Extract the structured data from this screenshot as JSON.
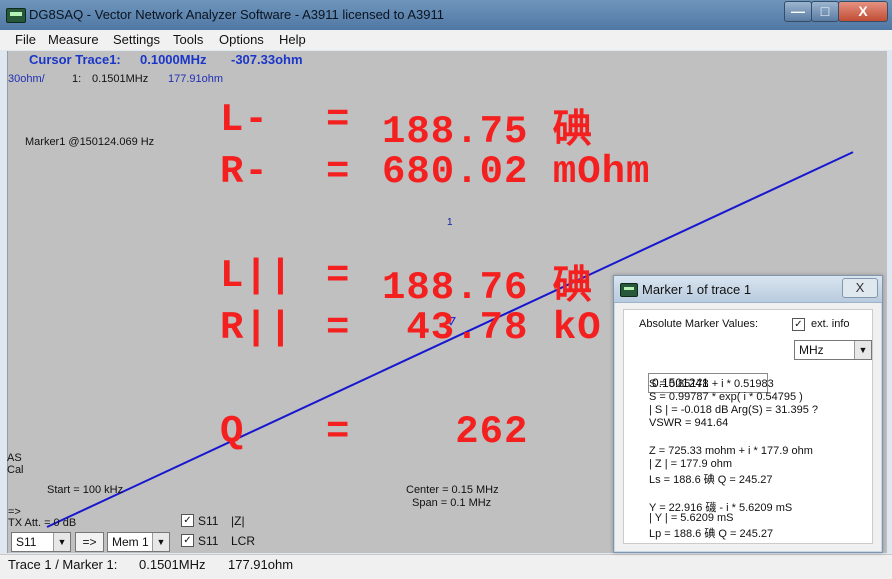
{
  "window": {
    "title": "DG8SAQ  -  Vector Network Analyzer Software  - A3911 licensed to A3911",
    "buttons": {
      "minimize": "—",
      "maximize": "□",
      "close": "X"
    }
  },
  "menubar": [
    "File",
    "Measure",
    "Settings",
    "Tools",
    "Options",
    "Help"
  ],
  "cursor": {
    "label": "Cursor Trace1:",
    "frequency": "0.1000MHz",
    "value": "-307.33ohm"
  },
  "scale_label": "30ohm/",
  "trace_readout": {
    "index": "1:",
    "frequency": "0.1501MHz",
    "value": "177.91ohm"
  },
  "marker_text": "Marker1 @150124.069 Hz",
  "marker_number": "1",
  "overlay": [
    {
      "label": "L-",
      "value": "188.75 碘"
    },
    {
      "label": "R-",
      "value": "680.02 mOhm"
    },
    {
      "label": "L||",
      "value": "188.76 碘"
    },
    {
      "label": "R||",
      "value": " 43.78 kO"
    },
    {
      "label": "Q",
      "value": "   262"
    }
  ],
  "bottom_left": {
    "as": "AS",
    "cal": "Cal",
    "arrow": "=>",
    "tx_att": "TX Att.  = 0 dB",
    "start": "Start = 100 kHz",
    "center": "Center = 0.15 MHz",
    "span": "Span = 0.1 MHz"
  },
  "controls": {
    "s_select": "S11",
    "arrow_button": "=>",
    "mem_select": "Mem 1",
    "trace_rows": [
      {
        "check": "✓",
        "param": "S11",
        "format": "|Z|",
        "param_color": "#1d4dff",
        "format_color": "#1d4dff"
      },
      {
        "check": "✓",
        "param": "S11",
        "format": "LCR",
        "param_color": "#f41f1f",
        "format_color": "#f41f1f"
      }
    ]
  },
  "chart_data": {
    "type": "line",
    "series": [
      {
        "x": [
          0.1,
          0.2
        ],
        "y": [
          -307.33,
          596.2
        ]
      }
    ],
    "xlim": [
      0.1,
      0.2
    ],
    "ylim": [
      -370,
      840
    ],
    "grid": false,
    "marker": {
      "x": 0.1501241,
      "y": 177.91
    }
  },
  "status": {
    "left": "Trace 1 / Marker 1:",
    "frequency": "0.1501MHz",
    "value": "177.91ohm"
  },
  "dialog": {
    "title": "Marker 1 of trace 1",
    "close": "X",
    "absolute_label": "Absolute Marker Values:",
    "ext_info_label": "ext. info",
    "ext_info_checked": "✓",
    "frequency_value": "0.1501241",
    "unit": "MHz",
    "lines": [
      "S = 0.85178 + i * 0.51983",
      "S = 0.99787 * exp( i * 0.54795 )",
      "| S | =    -0.018 dB    Arg(S) = 31.395 ?",
      "VSWR = 941.64",
      "Z = 725.33 mohm + i * 177.9 ohm",
      "| Z | = 177.9 ohm",
      "Ls = 188.6 碘      Q = 245.27",
      "Y = 22.916 礣    - i * 5.6209 mS",
      "| Y | = 5.6209 mS",
      "Lp = 188.6 碘      Q = 245.27"
    ]
  }
}
